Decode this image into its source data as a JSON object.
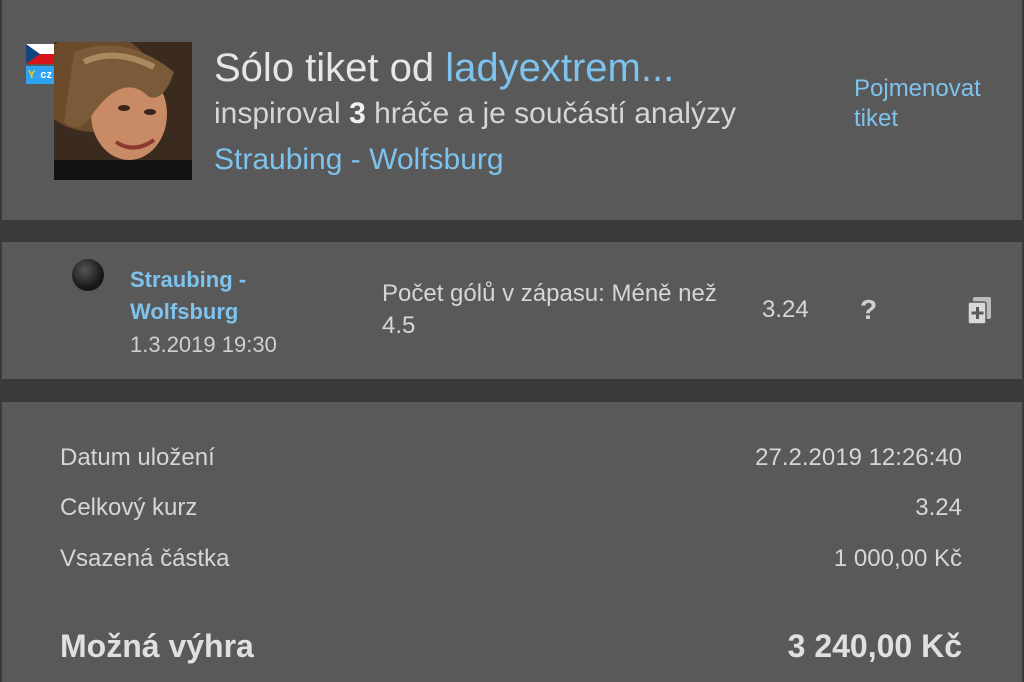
{
  "header": {
    "flag_country": "cz",
    "site_badge": "cz",
    "title_prefix": "Sólo tiket od ",
    "username": "ladyextrem...",
    "inspired_prefix": "inspiroval ",
    "inspired_count": "3",
    "inspired_suffix": " hráče a je součástí analýzy",
    "match_link": "Straubing - Wolfsburg",
    "rename_link": "Pojmenovat tiket"
  },
  "bet": {
    "match": "Straubing - Wolfsburg",
    "date": "1.3.2019 19:30",
    "description": "Počet gólů v zápasu: Méně než 4.5",
    "odds": "3.24",
    "help_glyph": "?"
  },
  "summary": {
    "saved_label": "Datum uložení",
    "saved_value": "27.2.2019 12:26:40",
    "total_odds_label": "Celkový kurz",
    "total_odds_value": "3.24",
    "stake_label": "Vsazená částka",
    "stake_value": "1 000,00 Kč",
    "win_label": "Možná výhra",
    "win_value": "3 240,00 Kč"
  },
  "icons": {
    "flag": "czech-flag-icon",
    "badge": "site-badge-icon",
    "status": "status-dot-icon",
    "help": "question-icon",
    "add": "add-to-ticket-icon"
  },
  "colors": {
    "panel": "#595959",
    "background": "#3a3a3a",
    "link": "#7ec3ee"
  }
}
